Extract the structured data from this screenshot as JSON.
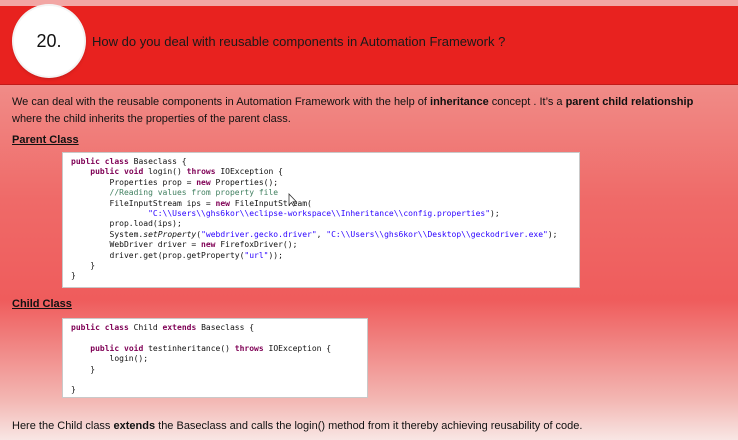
{
  "header": {
    "number": "20.",
    "title": "How  do you deal with reusable components in Automation Framework ?"
  },
  "intro": {
    "line1_before": "We can deal with the reusable components in Automation Framework with the help of ",
    "line1_bold1": "inheritance",
    "line1_middle": " concept . It’s a ",
    "line1_bold2": "parent child relationship",
    "line2": " where the child inherits the properties of the parent class."
  },
  "parent": {
    "label": "Parent Class",
    "code": [
      "public class Baseclass {",
      "    public void login() throws IOException {",
      "        Properties prop = new Properties();",
      "        //Reading values from property file",
      "        FileInputStream ips = new FileInputStream(",
      "                \"C:\\\\Users\\\\ghs6kor\\\\eclipse-workspace\\\\Inheritance\\\\config.properties\");",
      "        prop.load(ips);",
      "        System.setProperty(\"webdriver.gecko.driver\", \"C:\\\\Users\\\\ghs6kor\\\\Desktop\\\\geckodriver.exe\");",
      "        WebDriver driver = new FirefoxDriver();",
      "        driver.get(prop.getProperty(\"url\"));",
      "    }",
      "}"
    ]
  },
  "child": {
    "label": "Child Class",
    "code": [
      "public class Child extends Baseclass {",
      "",
      "    public void testinheritance() throws IOException {",
      "        login();",
      "    }",
      "",
      "}"
    ]
  },
  "outro": {
    "before": "Here the Child class ",
    "bold": "extends",
    "after": " the Baseclass and calls the login() method from it thereby achieving reusability of code."
  },
  "colors": {
    "header_red": "#e8221f",
    "keyword": "#7f0055",
    "comment": "#3f7f5f",
    "string": "#2a00ff"
  }
}
